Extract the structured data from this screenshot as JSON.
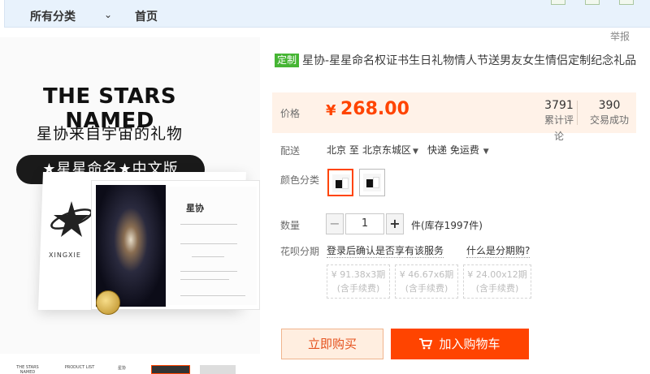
{
  "topbar": {
    "category_all": "所有分类",
    "home": "首页"
  },
  "report": "举报",
  "hero": {
    "title": "THE STARS NAMED",
    "subtitle": "星协来自宇宙的礼物",
    "pill": "★星星命名★中文版",
    "brand": "XINGXIE",
    "cert_title": "星协"
  },
  "product": {
    "tag": "定制",
    "title": "星协-星星命名权证书生日礼物情人节送男友女生情侣定制纪念礼品"
  },
  "price": {
    "label": "价格",
    "currency": "¥",
    "value": "268.00",
    "stats": [
      {
        "num": "3791",
        "label": "累计评论"
      },
      {
        "num": "390",
        "label": "交易成功"
      }
    ]
  },
  "shipping": {
    "label": "配送",
    "from": "北京 至",
    "to": "北京东城区",
    "method": "快递 免运费"
  },
  "color": {
    "label": "颜色分类"
  },
  "quantity": {
    "label": "数量",
    "minus": "−",
    "value": "1",
    "plus": "+",
    "stock": "件(库存1997件)"
  },
  "huabei": {
    "label": "花呗分期",
    "login_text": "登录后确认是否享有该服务",
    "what_text": "什么是分期购?",
    "options": [
      {
        "line1": "¥ 91.38x3期",
        "line2": "(含手续费)"
      },
      {
        "line1": "¥ 46.67x6期",
        "line2": "(含手续费)"
      },
      {
        "line1": "¥ 24.00x12期",
        "line2": "(含手续费)"
      }
    ]
  },
  "actions": {
    "buy_now": "立即购买",
    "add_cart": "加入购物车"
  },
  "thumbnails": [
    "THE STARS NAMED",
    "PRODUCT LIST",
    "星协"
  ],
  "colors": {
    "accent": "#ff4400",
    "price_bg": "#fff2e8",
    "tag_green": "#46b534",
    "topbar_bg": "#e8f2fc"
  }
}
